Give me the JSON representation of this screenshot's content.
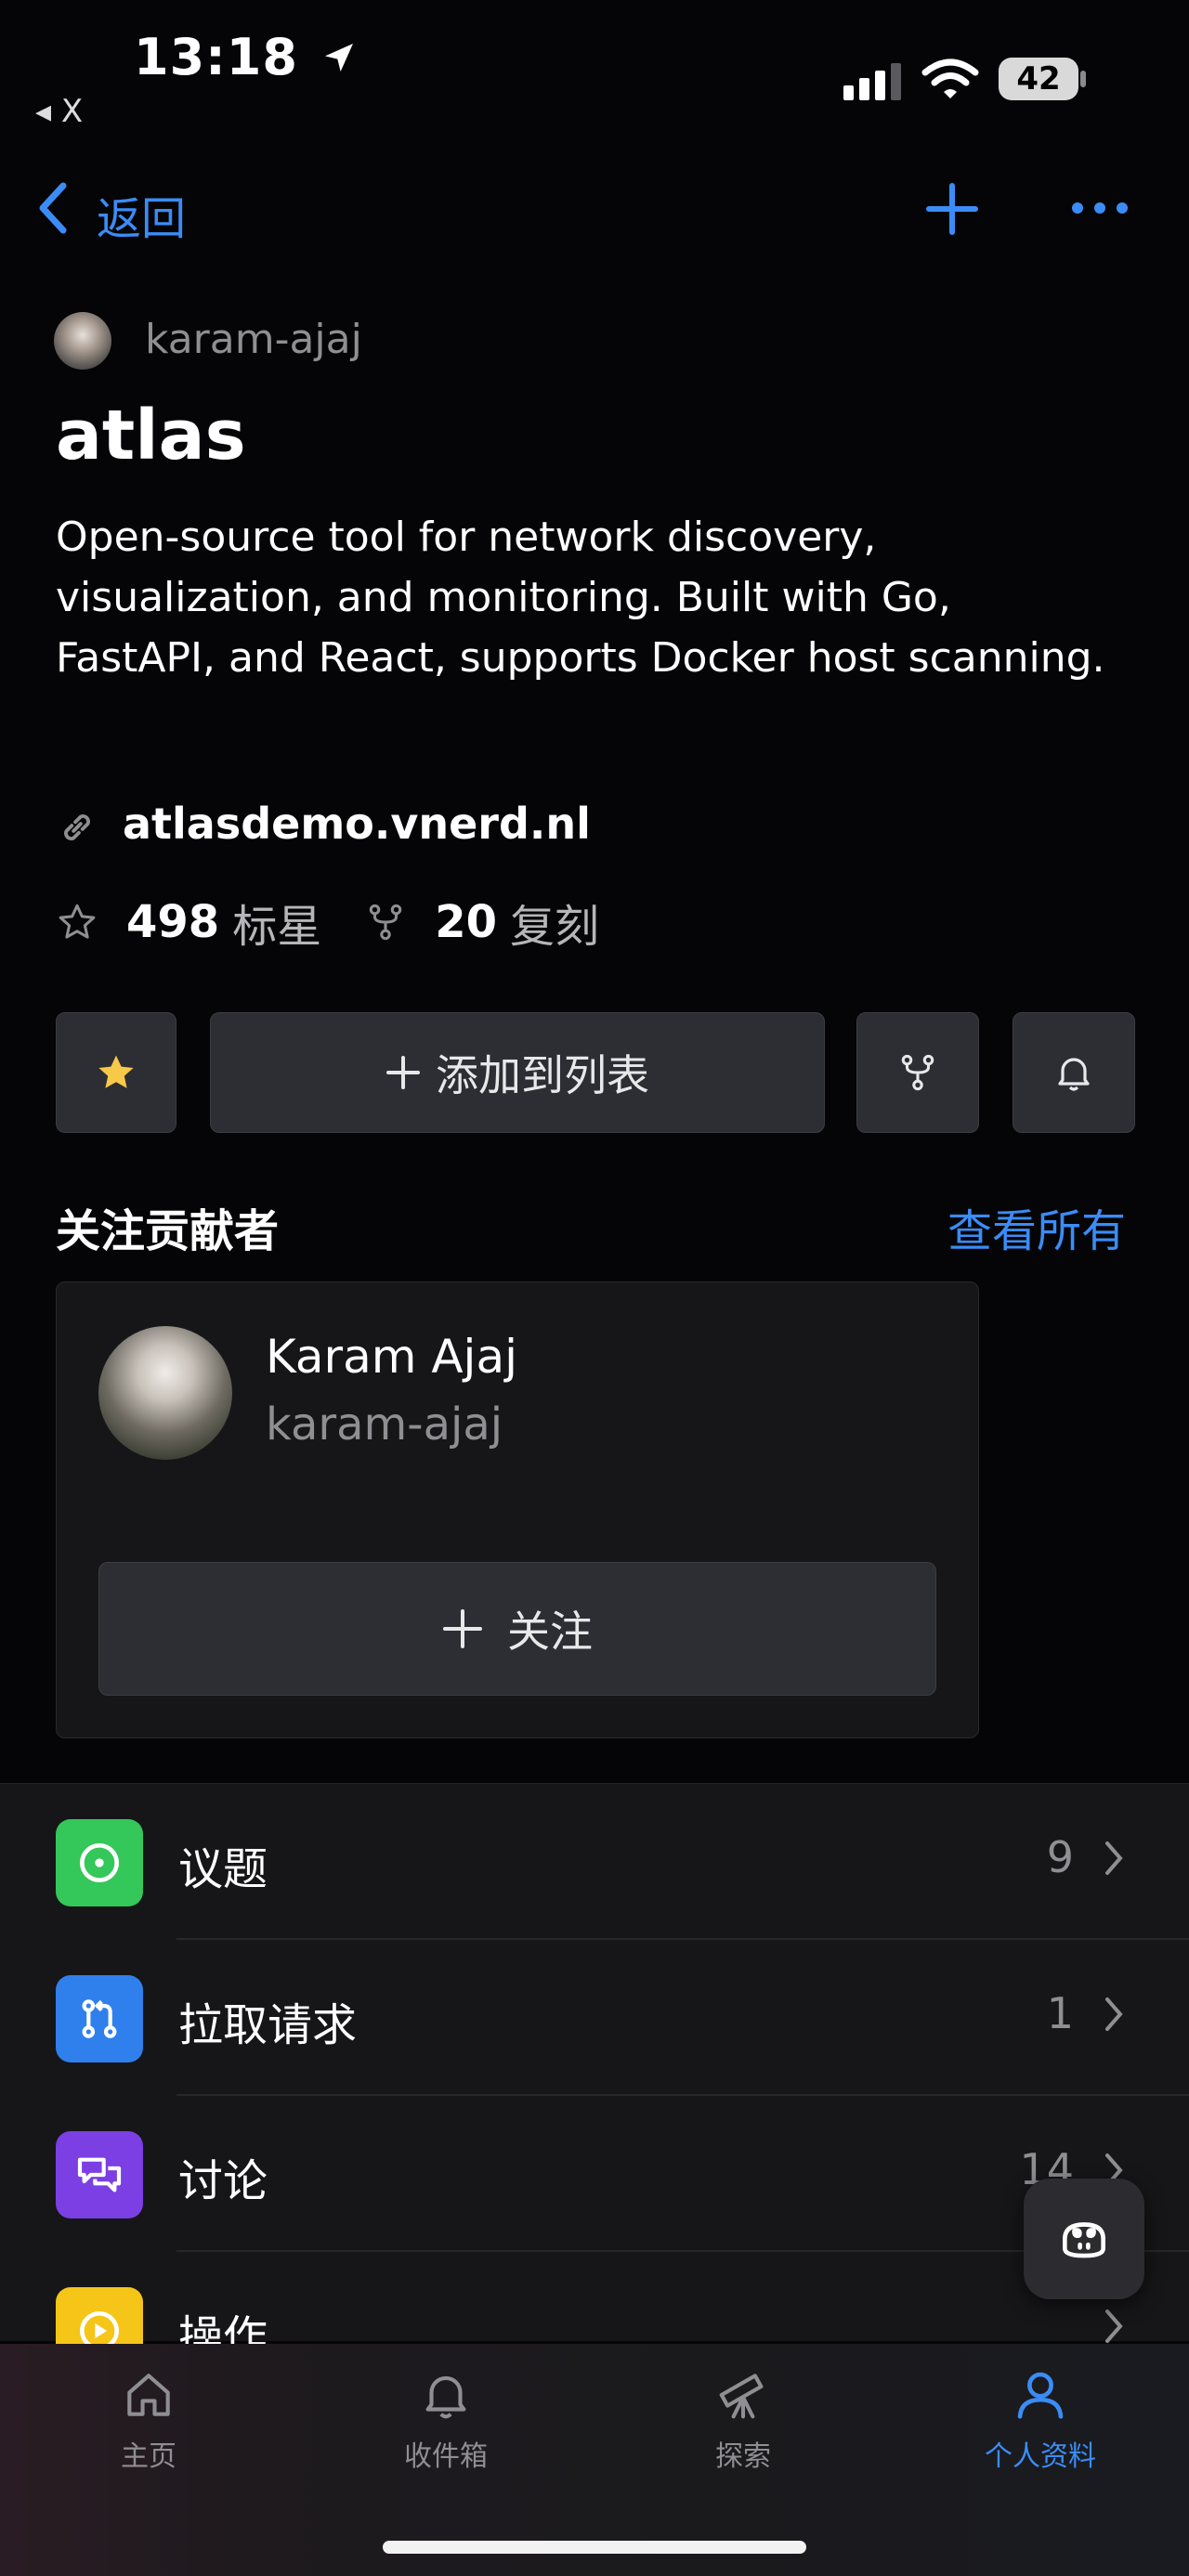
{
  "status_bar": {
    "time": "13:18",
    "back_app": "◂ X",
    "battery": "42"
  },
  "nav": {
    "back_label": "返回"
  },
  "repo": {
    "owner": "karam-ajaj",
    "name": "atlas",
    "description": "Open-source tool for network discovery, visualization, and monitoring. Built with Go, FastAPI, and React, supports Docker host scanning.",
    "link": "atlasdemo.vnerd.nl",
    "stars_count": "498",
    "stars_label": "标星",
    "forks_count": "20",
    "forks_label": "复刻"
  },
  "actions": {
    "add_to_list_label": "添加到列表"
  },
  "contributors": {
    "title": "关注贡献者",
    "see_all": "查看所有",
    "person": {
      "name": "Karam Ajaj",
      "login": "karam-ajaj",
      "follow_label": "关注"
    }
  },
  "list_rows": [
    {
      "label": "议题",
      "count": "9",
      "color": "#34c759",
      "icon": "issue-icon"
    },
    {
      "label": "拉取请求",
      "count": "1",
      "color": "#2f80ed",
      "icon": "pull-request-icon"
    },
    {
      "label": "讨论",
      "count": "14",
      "color": "#7b3fe4",
      "icon": "discussion-icon"
    },
    {
      "label": "操作",
      "count": "",
      "color": "#f5c518",
      "icon": "actions-icon"
    }
  ],
  "tabs": [
    {
      "label": "主页",
      "icon": "home-icon"
    },
    {
      "label": "收件箱",
      "icon": "bell-icon"
    },
    {
      "label": "探索",
      "icon": "telescope-icon"
    },
    {
      "label": "个人资料",
      "icon": "person-icon",
      "active": true
    }
  ],
  "colors": {
    "accent": "#3b8cf6",
    "background": "#050507",
    "surface": "#161619",
    "button": "#2d2e33"
  }
}
